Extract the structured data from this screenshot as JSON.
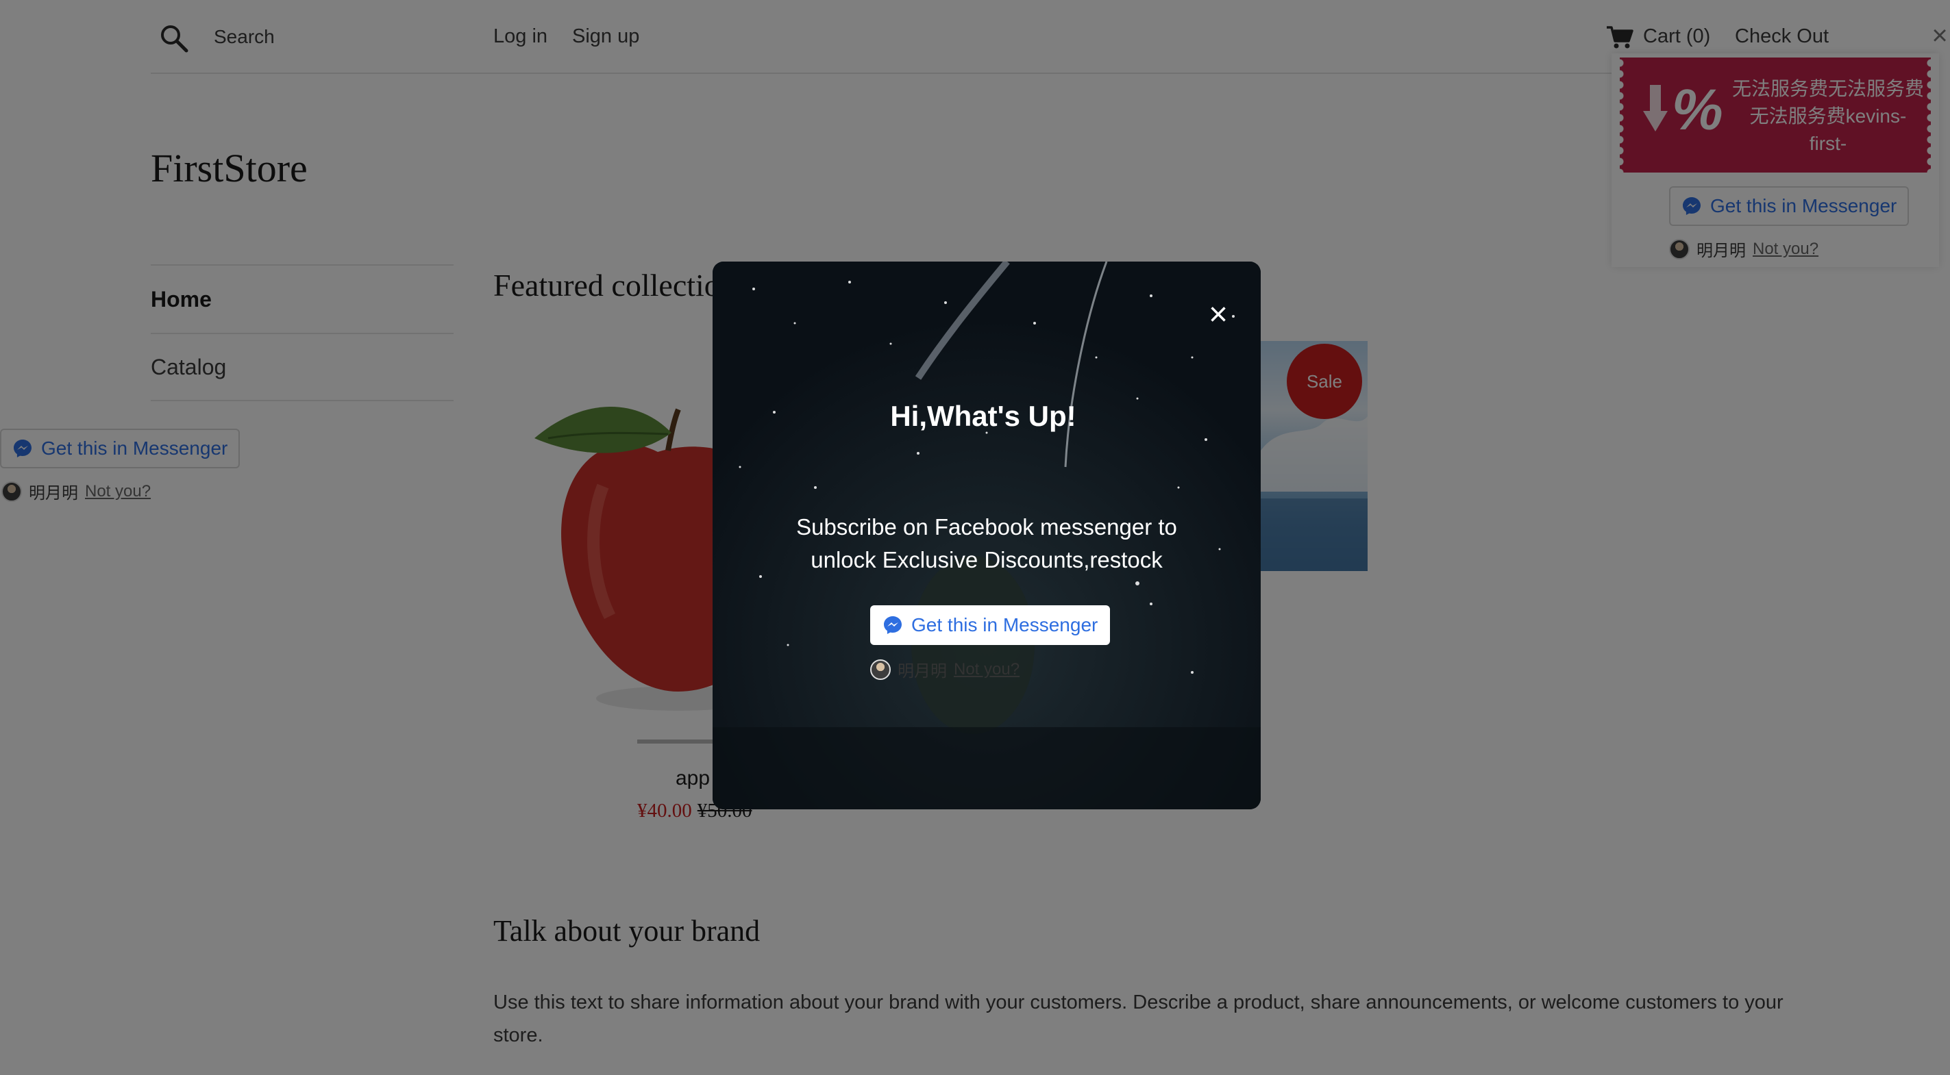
{
  "header": {
    "search_label": "Search",
    "login_label": "Log in",
    "signup_label": "Sign up",
    "cart_label": "Cart (0)",
    "checkout_label": "Check Out"
  },
  "store": {
    "title": "FirstStore"
  },
  "sidebar": {
    "items": [
      {
        "label": "Home",
        "active": true
      },
      {
        "label": "Catalog",
        "active": false
      }
    ]
  },
  "messenger": {
    "button_label": "Get this in Messenger",
    "user_name": "明月明",
    "not_you_label": "Not you?"
  },
  "featured": {
    "title": "Featured collectio",
    "product_name": "app",
    "price_sale": "¥40.00",
    "price_original": "¥50.00",
    "sale_badge": "Sale"
  },
  "brand": {
    "title": "Talk about your brand",
    "text": "Use this text to share information about your brand with your customers. Describe a product, share announcements, or welcome customers to your store."
  },
  "discount_widget": {
    "percent_symbol": "%",
    "text": "无法服务费无法服务费无法服务费kevins-first-"
  },
  "modal": {
    "close_symbol": "×",
    "title": "Hi,What's Up!",
    "text": "Subscribe on Facebook messenger to unlock Exclusive Discounts,restock",
    "button_label": "Get this in Messenger",
    "not_you_label": "Not you?"
  },
  "colors": {
    "messenger_blue": "#2e6ee0",
    "sale_red": "#c91f1f",
    "coupon_red": "#c0234a",
    "overlay": "rgba(0,0,0,0.5)"
  },
  "icons": {
    "search": "search-icon",
    "cart": "cart-icon",
    "messenger": "messenger-icon",
    "close": "close-icon"
  }
}
